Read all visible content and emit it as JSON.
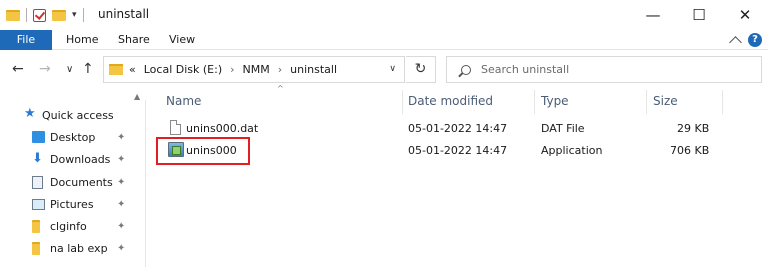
{
  "window": {
    "title": "uninstall",
    "controls": {
      "minimize": "—",
      "maximize": "☐",
      "close": "✕"
    }
  },
  "ribbon": {
    "tabs": [
      "File",
      "Home",
      "Share",
      "View"
    ],
    "help": "?"
  },
  "address_bar": {
    "path_prefix": "«",
    "segments": [
      "Local Disk (E:)",
      "NMM",
      "uninstall"
    ],
    "separator": "›"
  },
  "search": {
    "placeholder": "Search uninstall"
  },
  "sidebar": {
    "quick_access": "Quick access",
    "items": [
      {
        "label": "Desktop",
        "icon": "desktop-icon",
        "pinned": true
      },
      {
        "label": "Downloads",
        "icon": "download-icon",
        "pinned": true
      },
      {
        "label": "Documents",
        "icon": "documents-icon",
        "pinned": true
      },
      {
        "label": "Pictures",
        "icon": "pictures-icon",
        "pinned": true
      },
      {
        "label": "clginfo",
        "icon": "folder-icon",
        "pinned": true
      },
      {
        "label": "na lab exp",
        "icon": "folder-icon",
        "pinned": true
      }
    ]
  },
  "file_list": {
    "columns": [
      "Name",
      "Date modified",
      "Type",
      "Size"
    ],
    "rows": [
      {
        "name": "unins000.dat",
        "date": "05-01-2022 14:47",
        "type": "DAT File",
        "size": "29 KB",
        "icon": "dat-file-icon"
      },
      {
        "name": "unins000",
        "date": "05-01-2022 14:47",
        "type": "Application",
        "size": "706 KB",
        "icon": "application-icon"
      }
    ]
  },
  "colors": {
    "file_tab": "#1f6ab8",
    "highlight_box": "#e02020",
    "column_header_text": "#4b5d75"
  }
}
